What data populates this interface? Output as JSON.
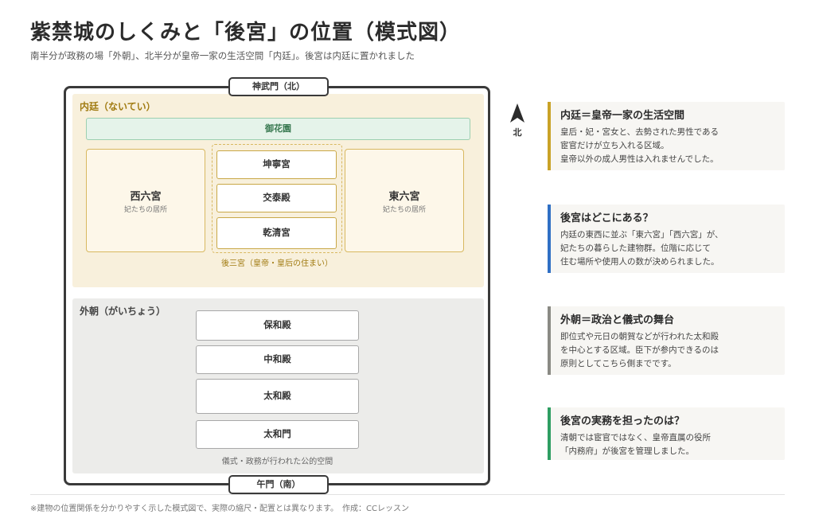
{
  "title": "紫禁城のしくみと「後宮」の位置（模式図）",
  "subtitle": "南半分が政務の場「外朝」、北半分が皇帝一家の生活空間「内廷」。後宮は内廷に置かれました",
  "diagram": {
    "north_gate": "神武門（北）",
    "south_gate": "午門（南）",
    "inner_court": {
      "label": "内廷（ないてい）",
      "garden": "御花園",
      "west": {
        "name": "西六宮",
        "desc": "妃たちの居所"
      },
      "east": {
        "name": "東六宮",
        "desc": "妃たちの居所"
      },
      "rear_three": [
        "坤寧宮",
        "交泰殿",
        "乾清宮"
      ],
      "rear_three_caption": "後三宮（皇帝・皇后の住まい）"
    },
    "outer_court": {
      "label": "外朝（がいちょう）",
      "halls": [
        "保和殿",
        "中和殿",
        "太和殿",
        "太和門"
      ],
      "caption": "儀式・政務が行われた公的空間"
    },
    "north_label": "北"
  },
  "notes": [
    {
      "title": "内廷＝皇帝一家の生活空間",
      "lines": [
        "皇后・妃・宮女と、去勢された男性である",
        "宦官だけが立ち入れる区域。",
        "皇帝以外の成人男性は入れませんでした。"
      ],
      "color": "#c9a227"
    },
    {
      "title": "後宮はどこにある？",
      "lines": [
        "内廷の東西に並ぶ「東六宮」「西六宮」が、",
        "妃たちの暮らした建物群。位階に応じて",
        "住む場所や使用人の数が決められました。"
      ],
      "color": "#2f6fc4"
    },
    {
      "title": "外朝＝政治と儀式の舞台",
      "lines": [
        "即位式や元日の朝賀などが行われた太和殿",
        "を中心とする区域。臣下が参内できるのは",
        "原則としてこちら側までです。"
      ],
      "color": "#8a8a84"
    },
    {
      "title": "後宮の実務を担ったのは？",
      "lines": [
        "清朝では宦官ではなく、皇帝直属の役所",
        "「内務府」が後宮を管理しました。"
      ],
      "color": "#2e9e62"
    }
  ],
  "footer": "※建物の位置関係を分かりやすく示した模式図で、実際の縮尺・配置とは異なります。　作成：CCレッスン"
}
